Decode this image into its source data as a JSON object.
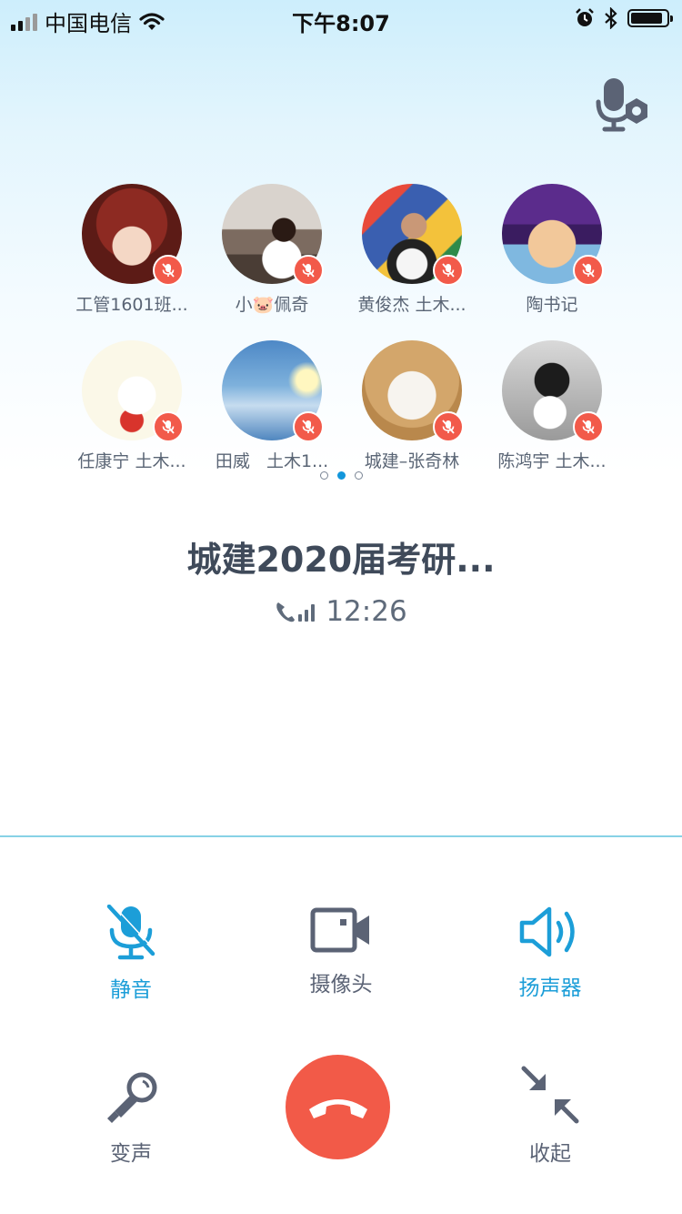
{
  "status_bar": {
    "carrier": "中国电信",
    "time": "下午8:07"
  },
  "call": {
    "group_title": "城建2020届考研...",
    "duration": "12:26"
  },
  "participants": [
    {
      "name": "工管1601班..."
    },
    {
      "name": "小🐷佩奇"
    },
    {
      "name": "黄俊杰 土木..."
    },
    {
      "name": "陶书记"
    },
    {
      "name": "任康宁 土木..."
    },
    {
      "name": "田威   土木1..."
    },
    {
      "name": "城建–张奇林"
    },
    {
      "name": "陈鸿宇 土木..."
    }
  ],
  "controls": {
    "mute": "静音",
    "camera": "摄像头",
    "speaker": "扬声器",
    "voice_changer": "变声",
    "collapse": "收起"
  },
  "colors": {
    "accent": "#1c9ed8",
    "hangup": "#f25a48",
    "mute_badge": "#f25a4a"
  }
}
